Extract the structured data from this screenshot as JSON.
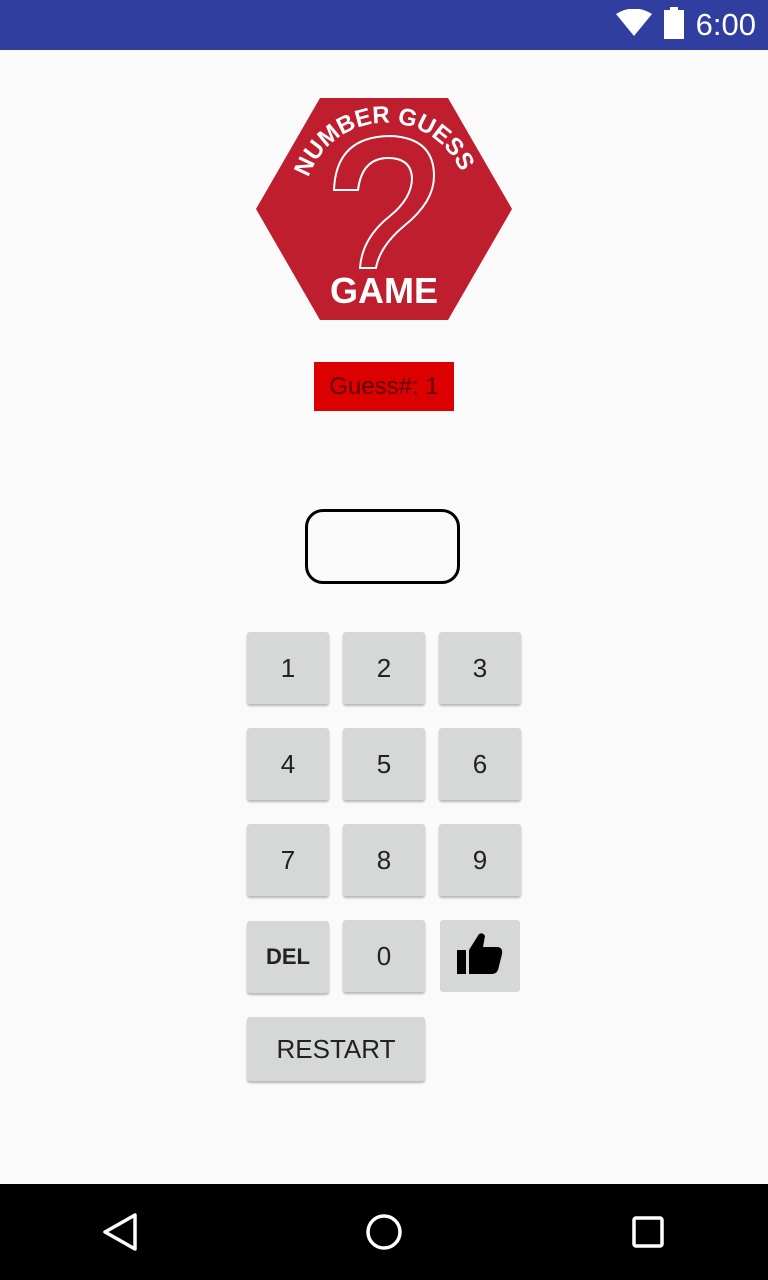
{
  "status_bar": {
    "time": "6:00",
    "icons": [
      "wifi-icon",
      "battery-icon"
    ],
    "background": "#303f9f"
  },
  "logo": {
    "arc_text": "NUMBER GUESS",
    "bottom_text": "GAME",
    "color": "#be1e2d"
  },
  "guess_counter": {
    "label": "Guess#: 1",
    "background": "#dd0000"
  },
  "guess_display": {
    "value": ""
  },
  "keypad": {
    "k1": "1",
    "k2": "2",
    "k3": "3",
    "k4": "4",
    "k5": "5",
    "k6": "6",
    "k7": "7",
    "k8": "8",
    "k9": "9",
    "del": "DEL",
    "k0": "0",
    "submit_icon": "thumbs-up-icon",
    "restart": "RESTART"
  },
  "nav_bar": {
    "icons": [
      "back-icon",
      "home-icon",
      "recents-icon"
    ]
  }
}
